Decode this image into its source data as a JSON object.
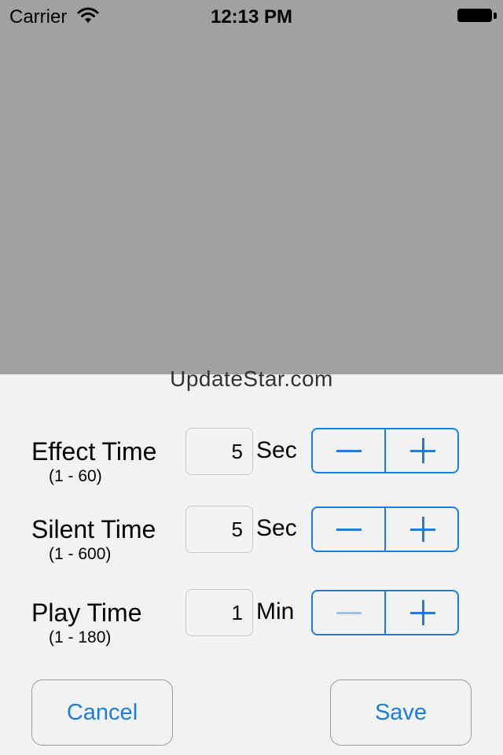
{
  "status_bar": {
    "carrier": "Carrier",
    "time": "12:13 PM"
  },
  "watermark": "UpdateStar.com",
  "rows": [
    {
      "label": "Effect Time",
      "range": "(1 - 60)",
      "value": "5",
      "unit": "Sec",
      "minus_enabled": true
    },
    {
      "label": "Silent Time",
      "range": "(1 - 600)",
      "value": "5",
      "unit": "Sec",
      "minus_enabled": true
    },
    {
      "label": "Play Time",
      "range": "(1 - 180)",
      "value": "1",
      "unit": "Min",
      "minus_enabled": false
    }
  ],
  "buttons": {
    "cancel": "Cancel",
    "save": "Save"
  },
  "colors": {
    "accent": "#1a7fdc",
    "overlay": "#a1a1a1",
    "panel": "#f2f2f2"
  }
}
